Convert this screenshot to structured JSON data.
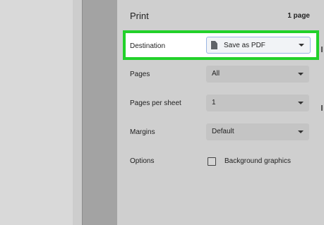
{
  "print": {
    "title": "Print",
    "page_count": "1 page",
    "destination": {
      "label": "Destination",
      "value": "Save as PDF"
    },
    "pages": {
      "label": "Pages",
      "value": "All"
    },
    "pages_per_sheet": {
      "label": "Pages per sheet",
      "value": "1"
    },
    "margins": {
      "label": "Margins",
      "value": "Default"
    },
    "options": {
      "label": "Options",
      "background_graphics": "Background graphics",
      "background_graphics_checked": false
    }
  },
  "colors": {
    "highlight": "#22d12a"
  },
  "icons": {
    "destination": "document-icon"
  }
}
